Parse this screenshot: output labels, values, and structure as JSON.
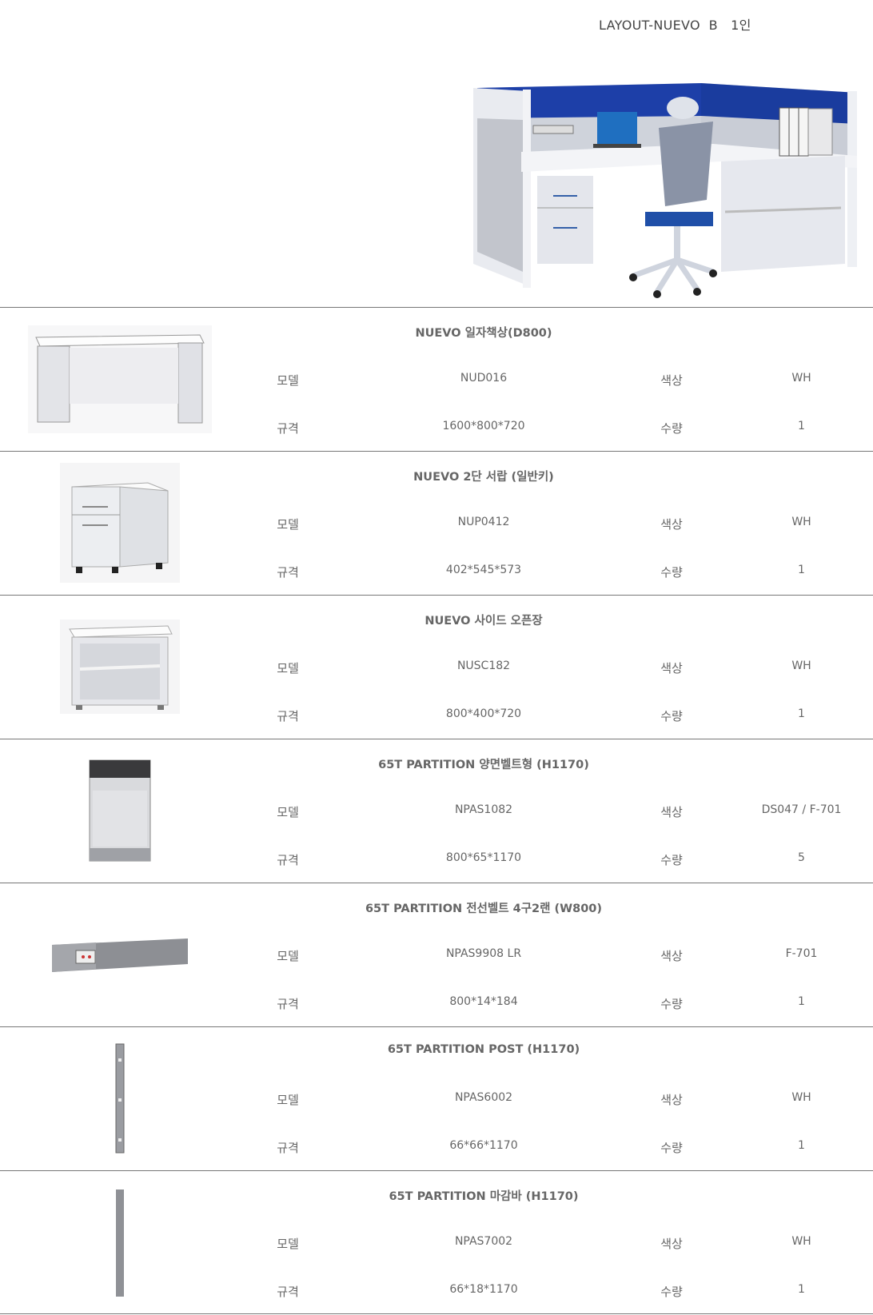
{
  "page": {
    "title": "LAYOUT-NUEVO  B   1인"
  },
  "labels": {
    "model": "모델",
    "color": "색상",
    "spec": "규격",
    "qty": "수량"
  },
  "products": [
    {
      "name": "NUEVO 일자책상(D800)",
      "model": "NUD016",
      "color": "WH",
      "spec": "1600*800*720",
      "qty": "1",
      "image": "desk"
    },
    {
      "name": "NUEVO 2단 서랍  (일반키)",
      "model": "NUP0412",
      "color": "WH",
      "spec": "402*545*573",
      "qty": "1",
      "image": "drawer"
    },
    {
      "name": "NUEVO 사이드 오픈장",
      "model": "NUSC182",
      "color": "WH",
      "spec": "800*400*720",
      "qty": "1",
      "image": "open-cabinet"
    },
    {
      "name": "65T PARTITION 양면벨트형 (H1170)",
      "model": "NPAS1082",
      "color": "DS047 / F-701",
      "spec": "800*65*1170",
      "qty": "5",
      "image": "partition-panel"
    },
    {
      "name": "65T PARTITION 전선벨트 4구2랜 (W800)",
      "model": "NPAS9908 LR",
      "color": "F-701",
      "spec": "800*14*184",
      "qty": "1",
      "image": "wire-belt"
    },
    {
      "name": "65T PARTITION POST (H1170)",
      "model": "NPAS6002",
      "color": "WH",
      "spec": "66*66*1170",
      "qty": "1",
      "image": "post"
    },
    {
      "name": "65T PARTITION 마감바 (H1170)",
      "model": "NPAS7002",
      "color": "WH",
      "spec": "66*18*1170",
      "qty": "1",
      "image": "end-bar"
    }
  ]
}
